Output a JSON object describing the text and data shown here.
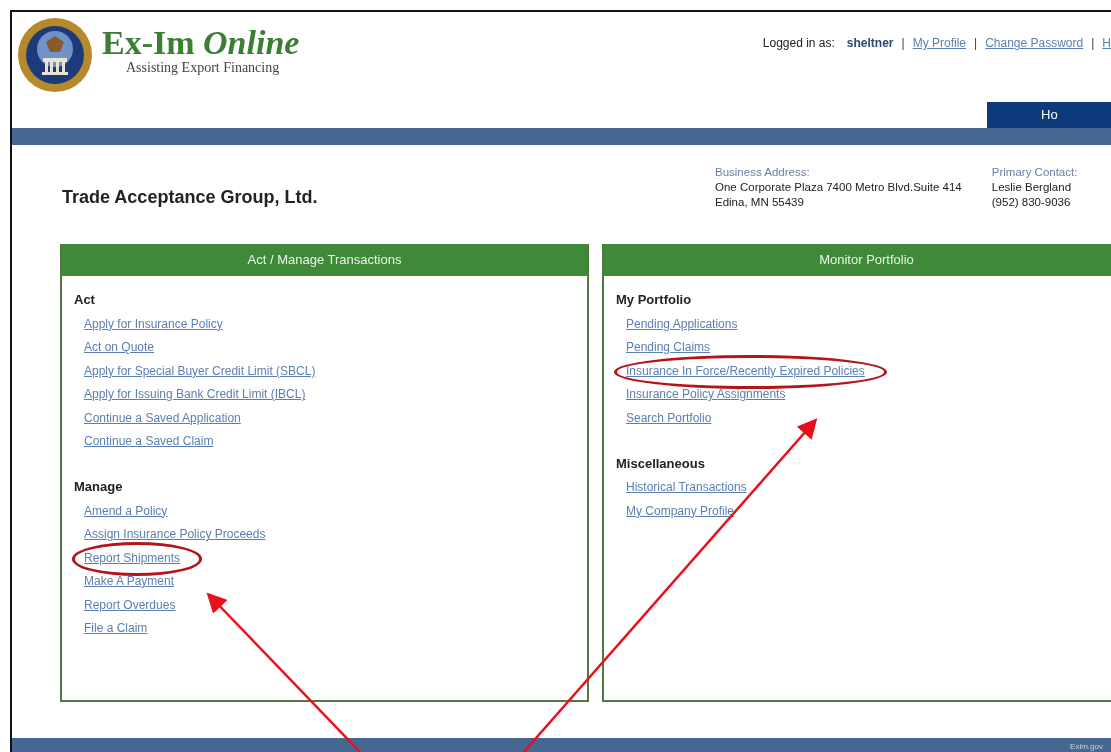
{
  "header": {
    "title": "Ex-Im *Online*",
    "tagline": "Assisting Export Financing",
    "logged_in_label": "Logged in as:",
    "username": "sheltner",
    "separator": "|",
    "links": [
      "My Profile",
      "Change Password",
      "H"
    ],
    "nav_tabs": [
      {
        "label": "Ho",
        "selected": true
      }
    ]
  },
  "company": {
    "name": "Trade Acceptance Group, Ltd.",
    "address_label": "Business Address:",
    "address_lines": [
      "One Corporate Plaza 7400 Metro Blvd.Suite 414",
      "Edina, MN 55439"
    ],
    "contact_label": "Primary Contact:",
    "contact_lines": [
      "Leslie Bergland",
      "(952) 830-9036"
    ]
  },
  "panels": [
    {
      "title": "Act / Manage Transactions",
      "sections": [
        {
          "heading": "Act",
          "links": [
            {
              "label": "Apply for Insurance Policy",
              "circled": false
            },
            {
              "label": "Act on Quote",
              "circled": false
            },
            {
              "label": "Apply for Special Buyer Credit Limit (SBCL)",
              "circled": false
            },
            {
              "label": "Apply for Issuing Bank Credit Limit (IBCL)",
              "circled": false
            },
            {
              "label": "Continue a Saved Application",
              "circled": false
            },
            {
              "label": "Continue a Saved Claim",
              "circled": false
            }
          ]
        },
        {
          "heading": "Manage",
          "links": [
            {
              "label": "Amend a Policy",
              "circled": false
            },
            {
              "label": "Assign Insurance Policy Proceeds",
              "circled": false
            },
            {
              "label": "Report Shipments",
              "circled": true
            },
            {
              "label": "Make A Payment",
              "circled": false
            },
            {
              "label": "Report Overdues",
              "circled": false
            },
            {
              "label": "File a Claim",
              "circled": false
            }
          ]
        }
      ]
    },
    {
      "title": "Monitor Portfolio",
      "sections": [
        {
          "heading": "My Portfolio",
          "links": [
            {
              "label": "Pending Applications",
              "circled": false
            },
            {
              "label": "Pending Claims",
              "circled": false
            },
            {
              "label": "Insurance In Force/Recently Expired Policies",
              "circled": true
            },
            {
              "label": "Insurance Policy Assignments",
              "circled": false
            },
            {
              "label": "Search Portfolio",
              "circled": false
            }
          ]
        },
        {
          "heading": "Miscellaneous",
          "links": [
            {
              "label": "Historical Transactions",
              "circled": false
            },
            {
              "label": "My Company Profile",
              "circled": false
            }
          ]
        }
      ]
    }
  ],
  "footer": {
    "text": "Exim.gov"
  }
}
